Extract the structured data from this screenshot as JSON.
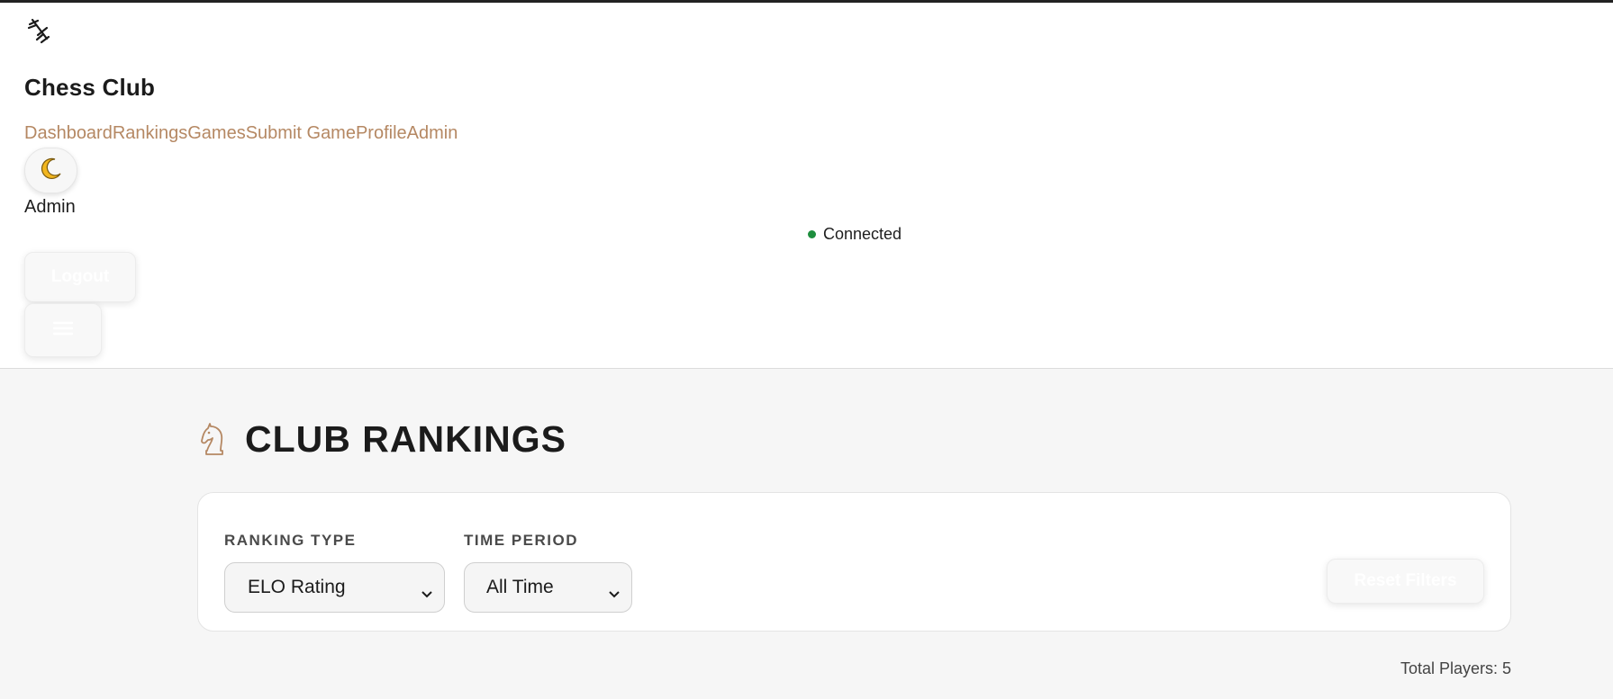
{
  "header": {
    "logo_icon": "chess-pieces-icon",
    "brand_title": "Chess Club",
    "nav": [
      {
        "label": "Dashboard"
      },
      {
        "label": "Rankings"
      },
      {
        "label": "Games"
      },
      {
        "label": "Submit Game"
      },
      {
        "label": "Profile"
      },
      {
        "label": "Admin"
      }
    ],
    "theme_toggle_icon": "crescent-moon-icon",
    "user_name": "Admin",
    "connection_status": "Connected",
    "logout_label": "Logout",
    "menu_icon": "hamburger-menu-icon"
  },
  "page": {
    "title_icon": "knight-icon",
    "title": "CLUB RANKINGS",
    "filters": {
      "ranking_type": {
        "label": "RANKING TYPE",
        "value": "ELO Rating"
      },
      "time_period": {
        "label": "TIME PERIOD",
        "value": "All Time"
      },
      "reset_label": "Reset Filters"
    },
    "total_players": "Total Players: 5"
  },
  "colors": {
    "accent": "#b58863",
    "connected": "#1e8e3e",
    "page_bg": "#f6f6f6",
    "header_bg": "#ffffff"
  }
}
